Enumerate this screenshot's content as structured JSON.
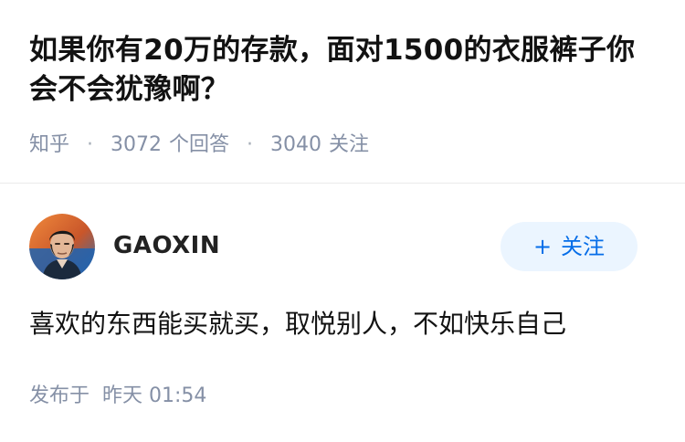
{
  "question": {
    "title": "如果你有20万的存款，面对1500的衣服裤子你会不会犹豫啊？",
    "source": "知乎",
    "answers_count": "3072",
    "answers_label": "个回答",
    "followers_count": "3040",
    "followers_label": "关注"
  },
  "answer": {
    "author_name": "GAOXIN",
    "follow_plus": "+",
    "follow_label": "关注",
    "content": "喜欢的东西能买就买，取悦别人，不如快乐自己",
    "published_label": "发布于",
    "published_time": "昨天 01:54"
  },
  "colors": {
    "accent": "#056de8",
    "follow_bg": "#ebf5ff",
    "meta_gray": "#8590a6",
    "text": "#121212"
  }
}
